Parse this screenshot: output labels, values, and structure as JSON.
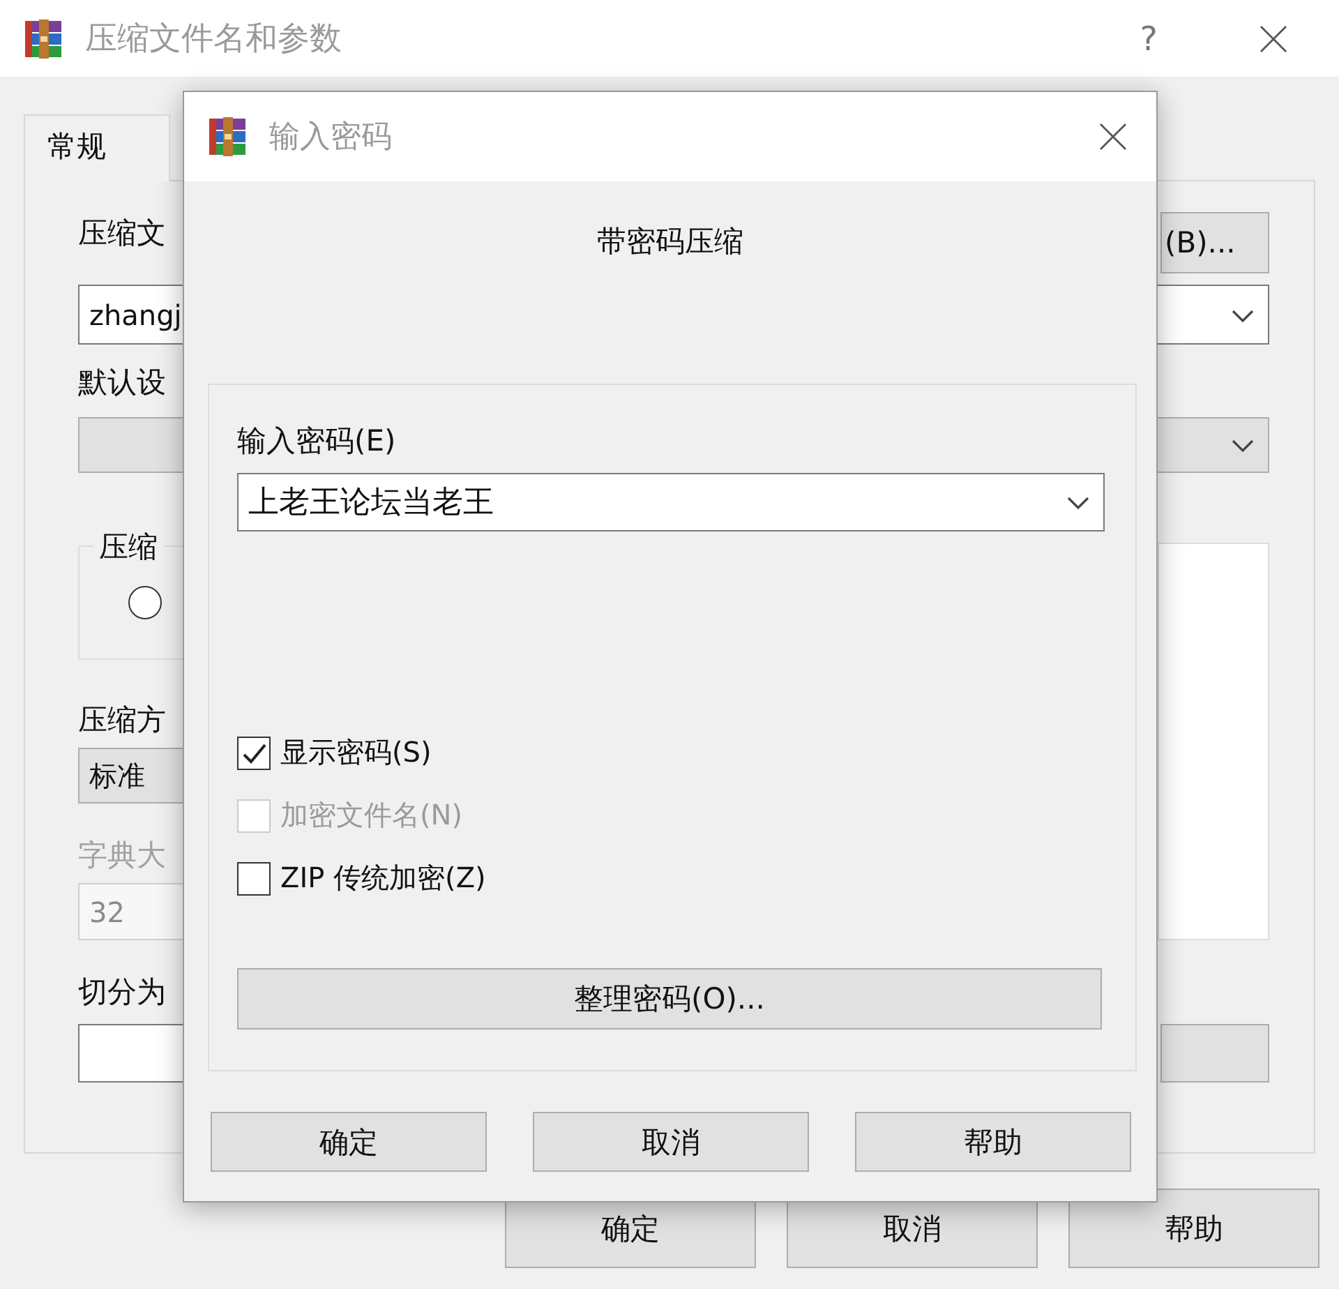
{
  "background_window": {
    "title": "压缩文件名和参数",
    "help_button": "?",
    "tabs": [
      {
        "label": "常规",
        "selected": true
      }
    ],
    "archive_name_label": "压缩文",
    "browse_button": "(B)...",
    "archive_name_value": "zhangj",
    "profile_label": "默认设",
    "format_group_label": "压缩",
    "format_radio": {
      "selected": false
    },
    "method_label": "压缩方",
    "method_value": "标准",
    "dictionary_label": "字典大",
    "dictionary_value": "32",
    "dictionary_disabled": true,
    "split_label": "切分为",
    "buttons": [
      "确定",
      "取消",
      "帮助"
    ]
  },
  "password_dialog": {
    "title": "输入密码",
    "heading": "带密码压缩",
    "password_label": "输入密码(E)",
    "password_value": "上老王论坛当老王",
    "options": [
      {
        "label": "显示密码(S)",
        "checked": true,
        "disabled": false
      },
      {
        "label": "加密文件名(N)",
        "checked": false,
        "disabled": true
      },
      {
        "label": "ZIP 传统加密(Z)",
        "checked": false,
        "disabled": false
      }
    ],
    "organize_button": "整理密码(O)...",
    "buttons": [
      "确定",
      "取消",
      "帮助"
    ]
  }
}
